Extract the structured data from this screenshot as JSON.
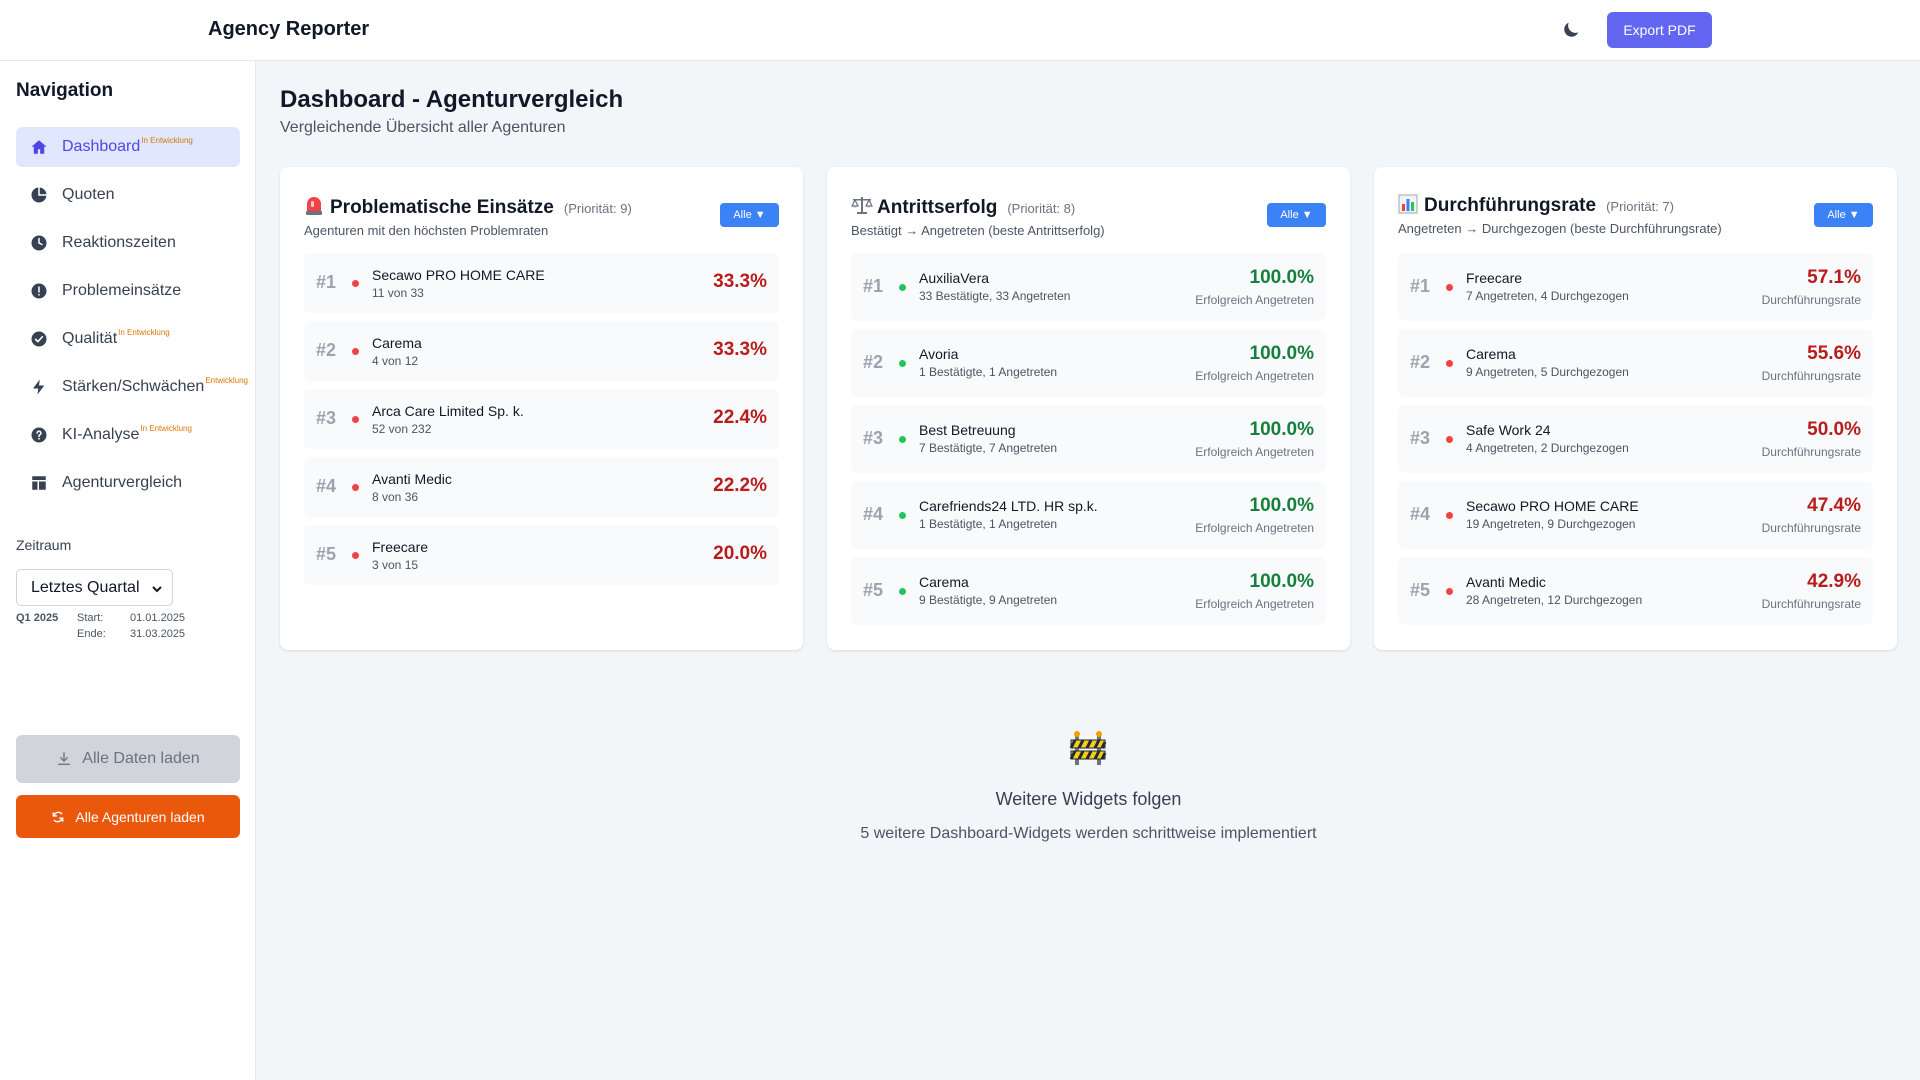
{
  "header": {
    "app_title": "Agency Reporter",
    "export_label": "Export PDF",
    "theme_icon": "moon-icon"
  },
  "sidebar": {
    "title": "Navigation",
    "items": [
      {
        "label": "Dashboard",
        "badge": "In Entwicklung",
        "icon": "home-icon",
        "active": true
      },
      {
        "label": "Quoten",
        "badge": "",
        "icon": "pie-chart-icon",
        "active": false
      },
      {
        "label": "Reaktionszeiten",
        "badge": "",
        "icon": "clock-icon",
        "active": false
      },
      {
        "label": "Problemeinsätze",
        "badge": "",
        "icon": "alert-icon",
        "active": false
      },
      {
        "label": "Qualität",
        "badge": "In Entwicklung",
        "icon": "check-circle-icon",
        "active": false
      },
      {
        "label": "Stärken/Schwächen",
        "badge": "Entwicklung",
        "icon": "bolt-icon",
        "active": false
      },
      {
        "label": "KI-Analyse",
        "badge": "In Entwicklung",
        "icon": "question-icon",
        "active": false
      },
      {
        "label": "Agenturvergleich",
        "badge": "",
        "icon": "layout-icon",
        "active": false
      }
    ],
    "zeitraum": {
      "label": "Zeitraum",
      "selected": "Letztes Quartal",
      "quarter": "Q1 2025",
      "start_label": "Start:",
      "start": "01.01.2025",
      "end_label": "Ende:",
      "end": "31.03.2025"
    },
    "load_all_label": "Alle Daten laden",
    "load_agencies_label": "Alle Agenturen laden"
  },
  "main": {
    "title": "Dashboard - Agenturvergleich",
    "subtitle": "Vergleichende Übersicht aller Agenturen",
    "cards": [
      {
        "title": "Problematische Einsätze",
        "priority": "(Priorität: 9)",
        "description": "Agenturen mit den höchsten Problemraten",
        "filter": "Alle ▼",
        "icon": "siren-icon",
        "rows": [
          {
            "rank": "#1",
            "name": "Secawo PRO HOME CARE",
            "sub": "11 von 33",
            "value": "33.3%",
            "status": "red"
          },
          {
            "rank": "#2",
            "name": "Carema",
            "sub": "4 von 12",
            "value": "33.3%",
            "status": "red"
          },
          {
            "rank": "#3",
            "name": "Arca Care Limited Sp. k.",
            "sub": "52 von 232",
            "value": "22.4%",
            "status": "red"
          },
          {
            "rank": "#4",
            "name": "Avanti Medic",
            "sub": "8 von 36",
            "value": "22.2%",
            "status": "red"
          },
          {
            "rank": "#5",
            "name": "Freecare",
            "sub": "3 von 15",
            "value": "20.0%",
            "status": "red"
          }
        ]
      },
      {
        "title": "Antrittserfolg",
        "priority": "(Priorität: 8)",
        "description": "Bestätigt → Angetreten (beste Antrittserfolg)",
        "filter": "Alle ▼",
        "icon": "scales-icon",
        "rows": [
          {
            "rank": "#1",
            "name": "AuxiliaVera",
            "sub": "33 Bestätigte, 33 Angetreten",
            "value": "100.0%",
            "value_sub": "Erfolgreich Angetreten",
            "status": "green"
          },
          {
            "rank": "#2",
            "name": "Avoria",
            "sub": "1 Bestätigte, 1 Angetreten",
            "value": "100.0%",
            "value_sub": "Erfolgreich Angetreten",
            "status": "green"
          },
          {
            "rank": "#3",
            "name": "Best Betreuung",
            "sub": "7 Bestätigte, 7 Angetreten",
            "value": "100.0%",
            "value_sub": "Erfolgreich Angetreten",
            "status": "green"
          },
          {
            "rank": "#4",
            "name": "Carefriends24 LTD. HR sp.k.",
            "sub": "1 Bestätigte, 1 Angetreten",
            "value": "100.0%",
            "value_sub": "Erfolgreich Angetreten",
            "status": "green"
          },
          {
            "rank": "#5",
            "name": "Carema",
            "sub": "9 Bestätigte, 9 Angetreten",
            "value": "100.0%",
            "value_sub": "Erfolgreich Angetreten",
            "status": "green"
          }
        ]
      },
      {
        "title": "Durchführungsrate",
        "priority": "(Priorität: 7)",
        "description": "Angetreten → Durchgezogen (beste Durchführungsrate)",
        "filter": "Alle ▼",
        "icon": "bar-chart-icon",
        "rows": [
          {
            "rank": "#1",
            "name": "Freecare",
            "sub": "7 Angetreten, 4 Durchgezogen",
            "value": "57.1%",
            "value_sub": "Durchführungsrate",
            "status": "red"
          },
          {
            "rank": "#2",
            "name": "Carema",
            "sub": "9 Angetreten, 5 Durchgezogen",
            "value": "55.6%",
            "value_sub": "Durchführungsrate",
            "status": "red"
          },
          {
            "rank": "#3",
            "name": "Safe Work 24",
            "sub": "4 Angetreten, 2 Durchgezogen",
            "value": "50.0%",
            "value_sub": "Durchführungsrate",
            "status": "red"
          },
          {
            "rank": "#4",
            "name": "Secawo PRO HOME CARE",
            "sub": "19 Angetreten, 9 Durchgezogen",
            "value": "47.4%",
            "value_sub": "Durchführungsrate",
            "status": "red"
          },
          {
            "rank": "#5",
            "name": "Avanti Medic",
            "sub": "28 Angetreten, 12 Durchgezogen",
            "value": "42.9%",
            "value_sub": "Durchführungsrate",
            "status": "red"
          }
        ]
      }
    ],
    "more": {
      "icon": "construction-icon",
      "title": "Weitere Widgets folgen",
      "subtitle": "5 weitere Dashboard-Widgets werden schrittweise implementiert"
    }
  },
  "colors": {
    "accent": "#6366f1",
    "nav_active_bg": "#e0e7ff",
    "nav_active_text": "#4f46e5",
    "filter_button": "#3b82f6",
    "load_agencies": "#ea580c",
    "negative": "#b91c1c",
    "positive": "#15803d",
    "dev_badge": "#d97706"
  }
}
